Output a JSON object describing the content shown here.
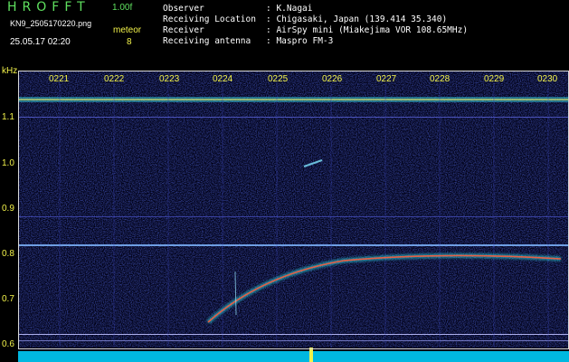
{
  "header": {
    "app_title": "HROFFT",
    "version": "1.00f",
    "file_name": "KN9_2505170220.png",
    "mode": "meteor",
    "datetime": "25.05.17 02:20",
    "count": "8",
    "meta": [
      {
        "label": "Observer",
        "value": ": K.Nagai"
      },
      {
        "label": "Receiving Location",
        "value": ": Chigasaki, Japan (139.414 35.340)"
      },
      {
        "label": "Receiver",
        "value": ": AirSpy mini (Miakejima VOR 108.65MHz)"
      },
      {
        "label": "Receiving antenna",
        "value": ": Maspro FM-3"
      }
    ]
  },
  "axis": {
    "unit": "kHz",
    "y_ticks": [
      "1.1",
      "1.0",
      "0.9",
      "0.8",
      "0.7",
      "0.6"
    ],
    "x_ticks": [
      "0221",
      "0222",
      "0223",
      "0224",
      "0225",
      "0226",
      "0227",
      "0228",
      "0229",
      "0230"
    ]
  },
  "colors": {
    "background": "#000000",
    "spectrogram_noise": "#1a1e8c",
    "header_green": "#5fe05f",
    "header_yellow": "#f2f24a",
    "frame": "#d8d8d8",
    "signal_core": "#ff5a3c",
    "signal_halo": "#2ee0e6"
  }
}
